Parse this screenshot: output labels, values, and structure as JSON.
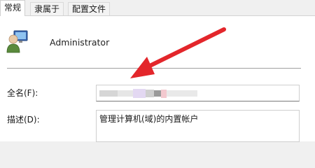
{
  "tabs": [
    {
      "label": "常规",
      "active": true
    },
    {
      "label": "隶属于",
      "active": false
    },
    {
      "label": "配置文件",
      "active": false
    }
  ],
  "account": {
    "icon": "user-computer-icon",
    "name": "Administrator"
  },
  "fields": {
    "fullname_label": "全名(F):",
    "fullname_value": "",
    "description_label": "描述(D):",
    "description_value": "管理计算机(域)的内置帐户"
  },
  "annotation": {
    "icon": "red-arrow-icon",
    "color": "#e3262b"
  }
}
